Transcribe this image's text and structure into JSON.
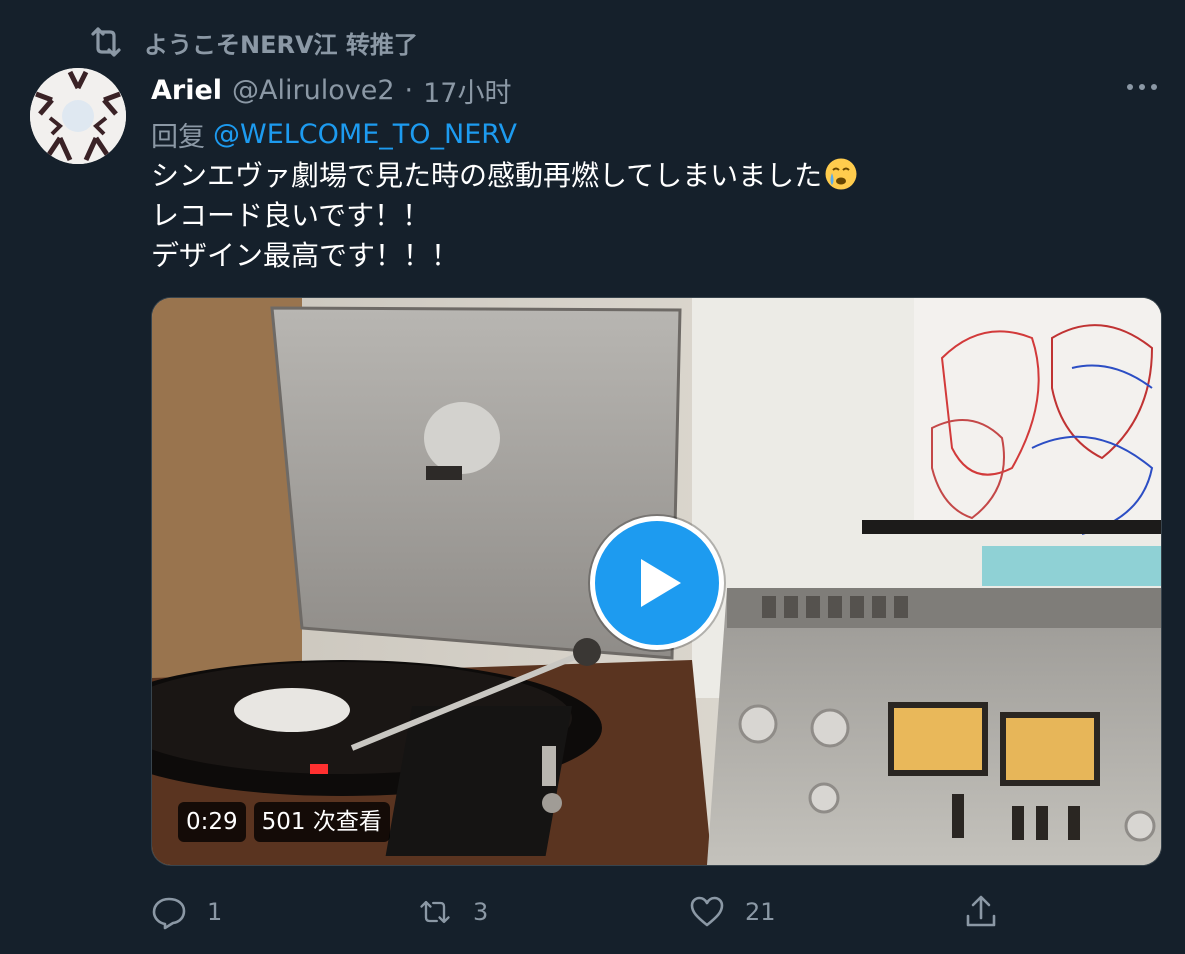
{
  "retweet": {
    "label": "ようこそNERV江 转推了",
    "icon": "retweet-icon"
  },
  "author": {
    "name": "Ariel",
    "handle": "@Alirulove2",
    "separator": "·",
    "time": "17小时"
  },
  "reply": {
    "label": "回复",
    "handle": "@WELCOME_TO_NERV"
  },
  "text": {
    "line1": "シンエヴァ劇場で見た時の感動再燃してしまいました",
    "line1_emoji": "crying-face-emoji",
    "line2": "レコード良いです！！",
    "line3": "デザイン最高です！！！"
  },
  "video": {
    "duration": "0:29",
    "views": "501 次查看",
    "accent": "#1d9bf0"
  },
  "actions": {
    "reply_count": "1",
    "retweet_count": "3",
    "like_count": "21"
  },
  "colors": {
    "background": "#15202b",
    "muted": "#8b98a5",
    "link": "#1d9bf0"
  }
}
